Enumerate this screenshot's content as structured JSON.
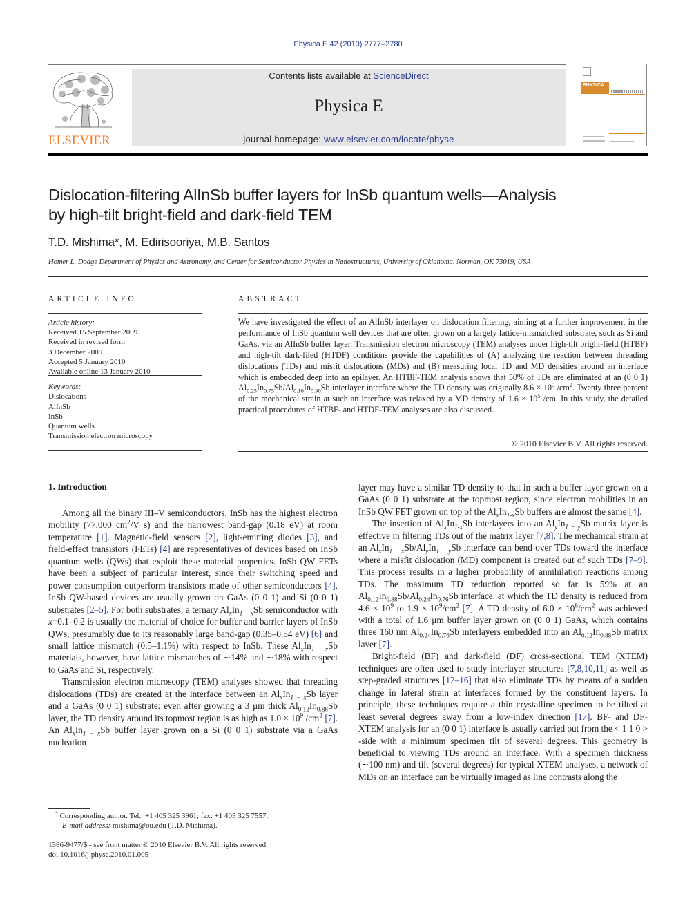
{
  "citation": "Physica E 42 (2010) 2777–2780",
  "header": {
    "publisher_logo_text": "ELSEVIER",
    "contents_prefix": "Contents lists available at ",
    "contents_link": "ScienceDirect",
    "journal_name": "Physica E",
    "homepage_prefix": "journal homepage: ",
    "homepage_link": "www.elsevier.com/locate/physe",
    "cover_title": "PHYSICA"
  },
  "article": {
    "title_line1": "Dislocation-filtering AlInSb buffer layers for InSb quantum wells—Analysis",
    "title_line2": "by high-tilt bright-field and dark-field TEM",
    "authors": "T.D. Mishima*, M. Edirisooriya, M.B. Santos",
    "affiliation": "Homer L. Dodge Department of Physics and Astronomy, and Center for Semiconductor Physics in Nanostructures, University of Oklahoma, Norman, OK 73019, USA"
  },
  "article_info": {
    "heading": "ARTICLE INFO",
    "history_label": "Article history:",
    "history": [
      "Received 15 September 2009",
      "Received in revised form",
      "3 December 2009",
      "Accepted 5 January 2010",
      "Available online 13 January 2010"
    ],
    "keywords_label": "Keywords:",
    "keywords": [
      "Dislocations",
      "AlInSb",
      "InSb",
      "Quantum wells",
      "Transmission electron microscopy"
    ]
  },
  "abstract": {
    "heading": "ABSTRACT",
    "p1": "We have investigated the effect of an AlInSb interlayer on dislocation filtering, aiming at a further improvement in the performance of InSb quantum well devices that are often grown on a largely lattice-mismatched substrate, such as Si and GaAs, via an AlInSb buffer layer. Transmission electron microscopy (TEM) analyses under high-tilt bright-field (HTBF) and high-tilt dark-filed (HTDF) conditions provide the capabilities of (A) analyzing the reaction between threading dislocations (TDs) and misfit dislocations (MDs) and (B) measuring local TD and MD densities around an interface which is embedded deep into an epilayer. An HTBF-TEM analysis shows that 50% of TDs are eliminated at an (0 0 1) ",
    "f1_al": "Al",
    "f1_al_sub": "0.25",
    "f1_in": "In",
    "f1_in_sub": "0.75",
    "f1_rest": "Sb/",
    "f2_al": "Al",
    "f2_al_sub": "0.10",
    "f2_in": "In",
    "f2_in_sub": "0.90",
    "p2": "Sb interlayer interface where the TD density was originally 8.6 × 10",
    "p2_sup": "9",
    "p3": " /cm",
    "p3_sup": "2",
    "p4": ". Twenty three percent of the mechanical strain at such an interface was relaxed by a MD density of 1.6 × 10",
    "p4_sup": "5",
    "p5": " /cm. In this study, the detailed practical procedures of HTBF- and HTDF-TEM analyses are also discussed.",
    "copyright": "© 2010 Elsevier B.V. All rights reserved."
  },
  "intro": {
    "heading": "1.  Introduction",
    "left": {
      "a1": "Among all the binary III–V semiconductors, InSb has the highest electron mobility (77,000 cm",
      "a1_sup": "2",
      "a2": "/V s) and the narrowest band-gap (0.18 eV) at room temperature ",
      "r1": "[1]",
      "a3": ". Magnetic-field sensors ",
      "r2": "[2]",
      "a4": ", light-emitting diodes ",
      "r3": "[3]",
      "a5": ", and field-effect transistors (FETs) ",
      "r4": "[4]",
      "a6": " are representatives of devices based on InSb quantum wells (QWs) that exploit these material properties. InSb QW FETs have been a subject of particular interest, since their switching speed and power consumption outperform transistors made of other semiconductors ",
      "r5": "[4]",
      "a7": ". InSb QW-based devices are usually grown on GaAs (0 0 1) and Si (0 0 1) substrates ",
      "r6": "[2–5]",
      "a8": ". For both substrates, a ternary Al",
      "x": "x",
      "in": "In",
      "onemx": "1 − x",
      "a9": "Sb semiconductor with ",
      "a9x": "x",
      "a10": "=0.1–0.2 is usually the material of choice for buffer and barrier layers of InSb QWs, presumably due to its reasonably large band-gap (0.35–0.54 eV) ",
      "r7": "[6]",
      "a11": " and small lattice mismatch (0.5–1.1%) with respect to InSb. These Al",
      "a12": "Sb materials, however, have lattice mismatches of ∼14% and ∼18% with respect to GaAs and Si, respectively.",
      "b1": "Transmission electron microscopy (TEM) analyses showed that threading dislocations (TDs) are created at the interface between an Al",
      "b2": "Sb layer and a GaAs (0 0 1) substrate: even after growing a 3 μm thick Al",
      "b2_sub1": "0.12",
      "b2_sub2": "0.88",
      "b3": "Sb layer, the TD density around its topmost region is as high as 1.0 × 10",
      "b3_sup": "9",
      "b4": " /cm",
      "b4_sup": "2",
      "r8": "[7]",
      "b5": ". An Al",
      "b6": "Sb buffer layer grown on a Si (0 0 1) substrate via a GaAs nucleation"
    },
    "right": {
      "c1": "layer may have a similar TD density to that in such a buffer layer grown on a GaAs (0 0 1) substrate at the topmost region, since electron mobilities in an InSb QW FET grown on top of the Al",
      "c1_sub": "x",
      "c1_in": "In",
      "c1_sub2": "1-x",
      "c2": "Sb buffers are almost the same ",
      "r1": "[4]",
      "c3": ".",
      "d1": "The insertion of Al",
      "d1_sub": "x",
      "d1_in": "In",
      "d1_sub2": "1-x",
      "d2": "Sb interlayers into an Al",
      "y": "y",
      "onemy": "1 − y",
      "d3": "Sb matrix layer is effective in filtering TDs out of the matrix layer ",
      "r2": "[7,8]",
      "d4": ". The mechanical strain at an Al",
      "onemx": "1 − x",
      "d5": "Sb/Al",
      "d6": "Sb interface can bend over TDs toward the interface where a misfit dislocation (MD) component is created out of such TDs ",
      "r3": "[7–9]",
      "d7": ". This process results in a higher probability of annihilation reactions among TDs. The maximum TD reduction reported so far is 59% at an Al",
      "s012": "0.12",
      "s088": "0.88",
      "s024": "0.24",
      "s076": "0.76",
      "d8": "Sb/Al",
      "d9": "Sb interface, at which the TD density is reduced from 4.6 × 10",
      "sup9": "9",
      "d10": " to 1.9 × 10",
      "d11": "/cm",
      "sup2": "2",
      "r4": "[7]",
      "d12": ". A TD density of 6.0 × 10",
      "sup8": "8",
      "d13": " was achieved with a total of 1.6 μm buffer layer grown on (0 0 1) GaAs, which contains three 160 nm Al",
      "d14": "Sb interlayers embedded into an Al",
      "d15": "Sb matrix layer ",
      "r5": "[7]",
      "e1": "Bright-field (BF) and dark-field (DF) cross-sectional TEM (XTEM) techniques are often used to study interlayer structures ",
      "r6": "[7,8,10,11]",
      "e2": " as well as step-graded structures ",
      "r7": "[12–16]",
      "e3": " that also eliminate TDs by means of a sudden change in lateral strain at interfaces formed by the constituent layers. In principle, these techniques require a thin crystalline specimen to be tilted at least several degrees away from a low-index direction ",
      "r8": "[17]",
      "e4": ". BF- and DF-XTEM analysis for an (0 0 1) interface is usually carried out from the  < 1 1 0 > -side with a minimum specimen tilt of several degrees. This geometry is beneficial to viewing TDs around an interface. With a specimen thickness (∼100 nm) and tilt (several degrees) for typical XTEM analyses, a network of MDs on an interface can be virtually imaged as line contrasts along the"
    }
  },
  "footnotes": {
    "star": "*",
    "corresponding": " Corresponding author. Tel.: +1 405 325 3961; fax: +1 405 325 7557.",
    "email_label": "E-mail address:",
    "email": " mishima@ou.edu (T.D. Mishima).",
    "front_matter": "1386-9477/$ - see front matter © 2010 Elsevier B.V. All rights reserved.",
    "doi": "doi:10.1016/j.physe.2010.01.005"
  },
  "colors": {
    "link": "#2b3b8f",
    "elsevier_orange": "#f47a20",
    "header_box": "#e6e6e6"
  }
}
